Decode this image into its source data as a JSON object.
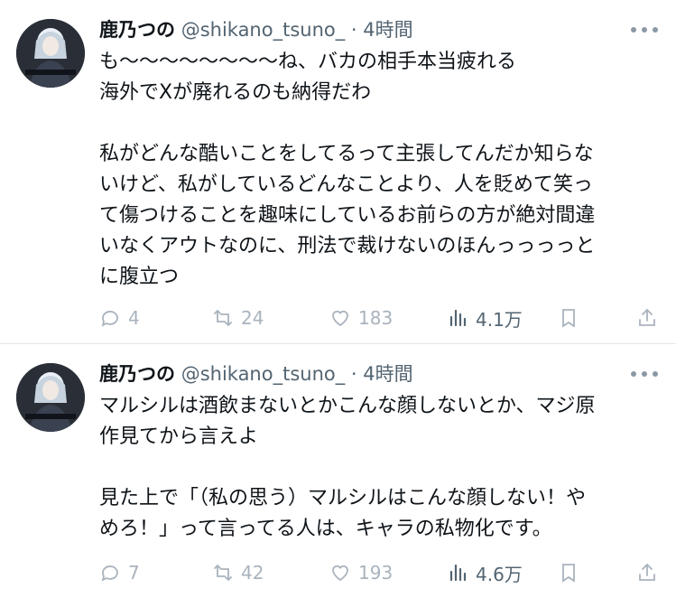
{
  "tweets": [
    {
      "author": {
        "display_name": "鹿乃つの",
        "handle": "@shikano_tsuno_",
        "separator": "·",
        "time": "4時間"
      },
      "lines": [
        "も〜〜〜〜〜〜〜〜ね、バカの相手本当疲れる",
        "海外でXが廃れるのも納得だわ",
        "",
        "私がどんな酷いことをしてるって主張してんだか知らな",
        "いけど、私がしているどんなことより、人を貶めて笑っ",
        "て傷つけることを趣味にしているお前らの方が絶対間違",
        "いなくアウトなのに、刑法で裁けないのほんっっっっと",
        "に腹立つ"
      ],
      "stats": {
        "replies": "4",
        "reposts": "24",
        "likes": "183",
        "views": "4.1万"
      }
    },
    {
      "author": {
        "display_name": "鹿乃つの",
        "handle": "@shikano_tsuno_",
        "separator": "·",
        "time": "4時間"
      },
      "lines": [
        "マルシルは酒飲まないとかこんな顔しないとか、マジ原",
        "作見てから言えよ",
        "",
        "見た上で「（私の思う）マルシルはこんな顔しない！や",
        "めろ！」って言ってる人は、キャラの私物化です。"
      ],
      "stats": {
        "replies": "7",
        "reposts": "42",
        "likes": "193",
        "views": "4.6万"
      }
    }
  ],
  "icons": {
    "reply": "reply-icon",
    "repost": "repost-icon",
    "like": "like-icon",
    "views": "views-icon",
    "bookmark": "bookmark-icon",
    "share": "share-icon",
    "more": "more-icon"
  },
  "colors": {
    "text": "#0f1419",
    "secondary": "#536471",
    "icon": "#a9b3bd",
    "divider": "#e1e6ea"
  }
}
